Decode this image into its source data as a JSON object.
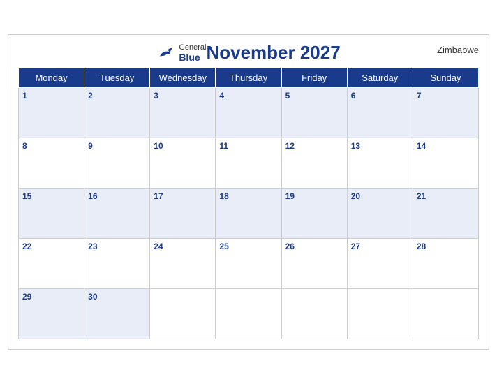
{
  "header": {
    "logo_general": "General",
    "logo_blue": "Blue",
    "title": "November 2027",
    "country": "Zimbabwe"
  },
  "days_of_week": [
    "Monday",
    "Tuesday",
    "Wednesday",
    "Thursday",
    "Friday",
    "Saturday",
    "Sunday"
  ],
  "weeks": [
    {
      "shaded": true,
      "days": [
        "1",
        "2",
        "3",
        "4",
        "5",
        "6",
        "7"
      ]
    },
    {
      "shaded": false,
      "days": [
        "8",
        "9",
        "10",
        "11",
        "12",
        "13",
        "14"
      ]
    },
    {
      "shaded": true,
      "days": [
        "15",
        "16",
        "17",
        "18",
        "19",
        "20",
        "21"
      ]
    },
    {
      "shaded": false,
      "days": [
        "22",
        "23",
        "24",
        "25",
        "26",
        "27",
        "28"
      ]
    },
    {
      "shaded": true,
      "days": [
        "29",
        "30",
        "",
        "",
        "",
        "",
        ""
      ]
    }
  ]
}
